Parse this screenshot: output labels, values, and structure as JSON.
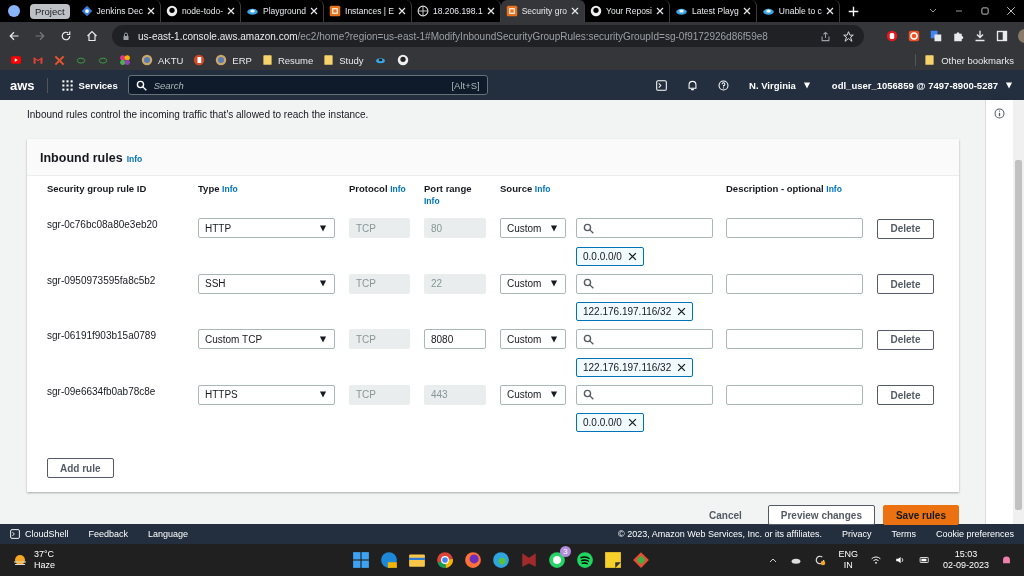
{
  "browser": {
    "tab_group": "Project",
    "tabs": [
      {
        "title": "Jenkins Dec",
        "kind": "diamond",
        "selected": false
      },
      {
        "title": "node-todo-",
        "kind": "octocat",
        "selected": false
      },
      {
        "title": "Playground",
        "kind": "cloud",
        "selected": false
      },
      {
        "title": "Instances | E",
        "kind": "aws",
        "selected": false
      },
      {
        "title": "18.206.198.1",
        "kind": "globe",
        "selected": false
      },
      {
        "title": "Security gro",
        "kind": "aws",
        "selected": true
      },
      {
        "title": "Your Reposi",
        "kind": "octocat",
        "selected": false
      },
      {
        "title": "Latest Playg",
        "kind": "cloud",
        "selected": false
      },
      {
        "title": "Unable to c",
        "kind": "cloud",
        "selected": false
      }
    ]
  },
  "address_bar": {
    "host": "us-east-1.console.aws.amazon.com",
    "path": "/ec2/home?region=us-east-1#ModifyInboundSecurityGroupRules:securityGroupId=sg-0f9172926d86f59e8"
  },
  "bookmarks": [
    {
      "kind": "video"
    },
    {
      "kind": "mail"
    },
    {
      "kind": "cross"
    },
    {
      "kind": "leaf"
    },
    {
      "kind": "leaf"
    },
    {
      "kind": "flower"
    },
    {
      "kind": "badge",
      "label": "AKTU"
    },
    {
      "kind": "slides"
    },
    {
      "kind": "badge",
      "label": "ERP"
    },
    {
      "kind": "folder",
      "label": "Resume"
    },
    {
      "kind": "folder",
      "label": "Study"
    },
    {
      "kind": "cloud"
    },
    {
      "kind": "octocat"
    }
  ],
  "other_bookmarks": "Other bookmarks",
  "aws_header": {
    "logo": "aws",
    "services": "Services",
    "search": {
      "placeholder": "Search",
      "shortcut": "[Alt+S]"
    },
    "region": "N. Virginia",
    "account": "odl_user_1056859 @ 7497-8900-5287"
  },
  "intro": "Inbound rules control the incoming traffic that's allowed to reach the instance.",
  "card": {
    "title": "Inbound rules",
    "title_info": "Info",
    "columns": [
      {
        "label": "Security group rule ID"
      },
      {
        "label": "Type",
        "info": "Info"
      },
      {
        "label": "Protocol",
        "info": "Info"
      },
      {
        "label": "Port range",
        "info": "Info"
      },
      {
        "label": "Source",
        "info": "Info"
      },
      {
        "label": "Description - optional",
        "info": "Info"
      }
    ],
    "rows": [
      {
        "id": "sgr-0c76bc08a80e3eb20",
        "type": "HTTP",
        "protocol": {
          "value": "TCP",
          "disabled": true
        },
        "port": {
          "value": "80",
          "disabled": true
        },
        "source": "Custom",
        "cidr": "0.0.0.0/0",
        "delete": "Delete"
      },
      {
        "id": "sgr-0950973595fa8c5b2",
        "type": "SSH",
        "protocol": {
          "value": "TCP",
          "disabled": true
        },
        "port": {
          "value": "22",
          "disabled": true
        },
        "source": "Custom",
        "cidr": "122.176.197.116/32",
        "delete": "Delete"
      },
      {
        "id": "sgr-06191f903b15a0789",
        "type": "Custom TCP",
        "protocol": {
          "value": "TCP",
          "disabled": true
        },
        "port": {
          "value": "8080",
          "disabled": false
        },
        "source": "Custom",
        "cidr": "122.176.197.116/32",
        "delete": "Delete"
      },
      {
        "id": "sgr-09e6634fb0ab78c8e",
        "type": "HTTPS",
        "protocol": {
          "value": "TCP",
          "disabled": true
        },
        "port": {
          "value": "443",
          "disabled": true
        },
        "source": "Custom",
        "cidr": "0.0.0.0/0",
        "delete": "Delete"
      }
    ],
    "add_rule": "Add rule"
  },
  "actions": {
    "cancel": "Cancel",
    "preview": "Preview changes",
    "save": "Save rules"
  },
  "footer": {
    "left": [
      "CloudShell",
      "Feedback",
      "Language"
    ],
    "copyright": "© 2023, Amazon Web Services, Inc. or its affiliates.",
    "links": [
      "Privacy",
      "Terms",
      "Cookie preferences"
    ]
  },
  "taskbar": {
    "temperature": "37°C",
    "weather": "Haze",
    "chat_badge": "3",
    "language": "ENG",
    "region": "IN",
    "time": "15:03",
    "date": "02-09-2023"
  }
}
